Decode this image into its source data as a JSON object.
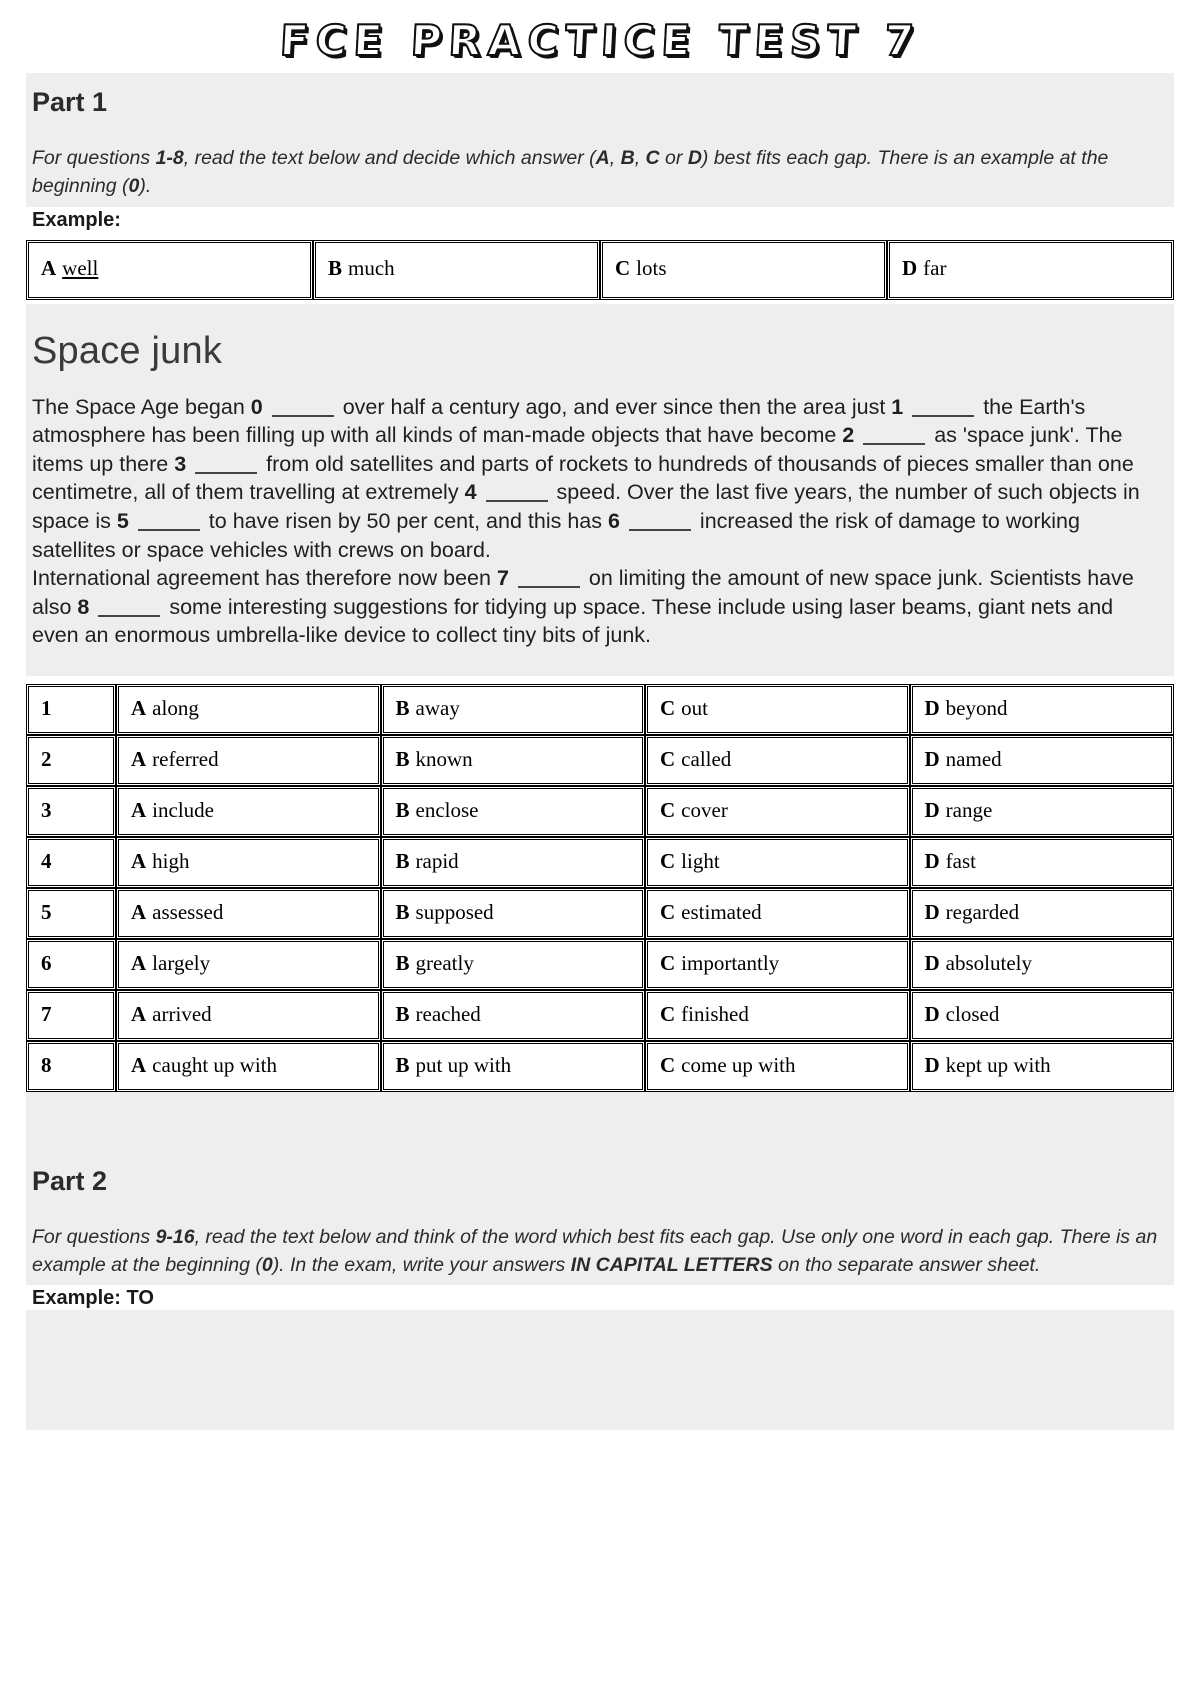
{
  "document": {
    "title": "FCE PRACTICE TEST 7"
  },
  "part1": {
    "heading": "Part 1",
    "instructions_html": "For questions <b>1-8</b>, read the text below and decide which answer (<b>A</b>, <b>B</b>, <b>C</b> or <b>D</b>) best fits each gap. There is an example at the beginning (<b>0</b>).",
    "instructions_text": "For questions 1-8, read the text below and decide which answer (A, B, C or D) best fits each gap. There is an example at the beginning (0).",
    "example_label": "Example:",
    "example_row": {
      "options": [
        {
          "letter": "A",
          "text": "well",
          "underlined": true
        },
        {
          "letter": "B",
          "text": "much",
          "underlined": false
        },
        {
          "letter": "C",
          "text": "lots",
          "underlined": false
        },
        {
          "letter": "D",
          "text": "far",
          "underlined": false
        }
      ]
    },
    "article": {
      "heading": "Space junk",
      "paragraphs": [
        "The Space Age began 0 _____ over half a century ago, and ever since then the area just 1 _____ the Earth's atmosphere has been filling up with all kinds of man-made objects that have become 2 _____ as 'space junk'. The items up there 3 _____ from old satellites and parts of rockets to hundreds of thousands of pieces smaller than one centimetre, all of them travelling at extremely 4 _____ speed. Over the last five years, the number of such objects in space is 5 _____ to have risen by 50 per cent, and this has 6 _____ increased the risk of damage to working satellites or space vehicles with crews on board.",
        "International agreement has therefore now been 7 _____ on limiting the amount of new space junk. Scientists have also 8 _____ some interesting suggestions for tidying up space. These include using laser beams, giant nets and even an enormous umbrella-like device to collect tiny bits of junk."
      ]
    },
    "questions": [
      {
        "number": "1",
        "options": [
          {
            "letter": "A",
            "text": "along"
          },
          {
            "letter": "B",
            "text": "away"
          },
          {
            "letter": "C",
            "text": "out"
          },
          {
            "letter": "D",
            "text": "beyond"
          }
        ]
      },
      {
        "number": "2",
        "options": [
          {
            "letter": "A",
            "text": "referred"
          },
          {
            "letter": "B",
            "text": "known"
          },
          {
            "letter": "C",
            "text": "called"
          },
          {
            "letter": "D",
            "text": "named"
          }
        ]
      },
      {
        "number": "3",
        "options": [
          {
            "letter": "A",
            "text": "include"
          },
          {
            "letter": "B",
            "text": "enclose"
          },
          {
            "letter": "C",
            "text": "cover"
          },
          {
            "letter": "D",
            "text": "range"
          }
        ]
      },
      {
        "number": "4",
        "options": [
          {
            "letter": "A",
            "text": "high"
          },
          {
            "letter": "B",
            "text": "rapid"
          },
          {
            "letter": "C",
            "text": "light"
          },
          {
            "letter": "D",
            "text": "fast"
          }
        ]
      },
      {
        "number": "5",
        "options": [
          {
            "letter": "A",
            "text": "assessed"
          },
          {
            "letter": "B",
            "text": "supposed"
          },
          {
            "letter": "C",
            "text": "estimated"
          },
          {
            "letter": "D",
            "text": "regarded"
          }
        ]
      },
      {
        "number": "6",
        "options": [
          {
            "letter": "A",
            "text": "largely"
          },
          {
            "letter": "B",
            "text": "greatly"
          },
          {
            "letter": "C",
            "text": "importantly"
          },
          {
            "letter": "D",
            "text": "absolutely"
          }
        ]
      },
      {
        "number": "7",
        "options": [
          {
            "letter": "A",
            "text": "arrived"
          },
          {
            "letter": "B",
            "text": "reached"
          },
          {
            "letter": "C",
            "text": "finished"
          },
          {
            "letter": "D",
            "text": "closed"
          }
        ]
      },
      {
        "number": "8",
        "options": [
          {
            "letter": "A",
            "text": "caught up with"
          },
          {
            "letter": "B",
            "text": "put up with"
          },
          {
            "letter": "C",
            "text": "come up with"
          },
          {
            "letter": "D",
            "text": "kept up with"
          }
        ]
      }
    ]
  },
  "part2": {
    "heading": "Part 2",
    "instructions_html": "For questions <b>9-16</b>, read the text below and think of the word which best fits each gap. Use only one word in each gap. There is an example at the beginning (<b>0</b>). In the exam, write your answers <b>IN CAPITAL LETTERS</b> on tho separate answer sheet.",
    "instructions_text": "For questions 9-16, read the text below and think of the word which best fits each gap. Use only one word in each gap. There is an example at the beginning (0). In the exam, write your answers IN CAPITAL LETTERS on tho separate answer sheet.",
    "example_label": "Example: TO"
  }
}
